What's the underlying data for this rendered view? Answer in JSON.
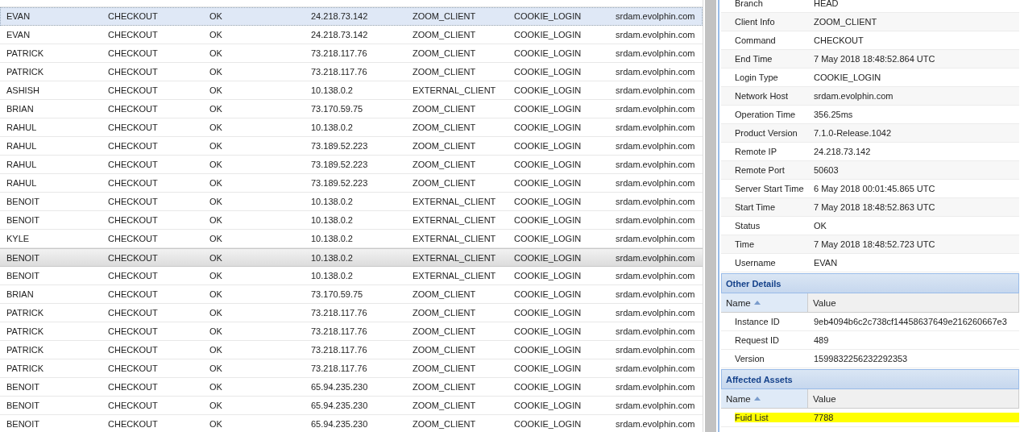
{
  "log_table": {
    "rows": [
      {
        "cells": [
          "EVAN",
          "CHECKOUT",
          "OK",
          "24.218.73.142",
          "ZOOM_CLIENT",
          "COOKIE_LOGIN",
          "srdam.evolphin.com"
        ],
        "selected": true,
        "hovered": false
      },
      {
        "cells": [
          "EVAN",
          "CHECKOUT",
          "OK",
          "24.218.73.142",
          "ZOOM_CLIENT",
          "COOKIE_LOGIN",
          "srdam.evolphin.com"
        ],
        "selected": false,
        "hovered": false
      },
      {
        "cells": [
          "PATRICK",
          "CHECKOUT",
          "OK",
          "73.218.117.76",
          "ZOOM_CLIENT",
          "COOKIE_LOGIN",
          "srdam.evolphin.com"
        ],
        "selected": false,
        "hovered": false
      },
      {
        "cells": [
          "PATRICK",
          "CHECKOUT",
          "OK",
          "73.218.117.76",
          "ZOOM_CLIENT",
          "COOKIE_LOGIN",
          "srdam.evolphin.com"
        ],
        "selected": false,
        "hovered": false
      },
      {
        "cells": [
          "ASHISH",
          "CHECKOUT",
          "OK",
          "10.138.0.2",
          "EXTERNAL_CLIENT",
          "COOKIE_LOGIN",
          "srdam.evolphin.com"
        ],
        "selected": false,
        "hovered": false
      },
      {
        "cells": [
          "BRIAN",
          "CHECKOUT",
          "OK",
          "73.170.59.75",
          "ZOOM_CLIENT",
          "COOKIE_LOGIN",
          "srdam.evolphin.com"
        ],
        "selected": false,
        "hovered": false
      },
      {
        "cells": [
          "RAHUL",
          "CHECKOUT",
          "OK",
          "10.138.0.2",
          "ZOOM_CLIENT",
          "COOKIE_LOGIN",
          "srdam.evolphin.com"
        ],
        "selected": false,
        "hovered": false
      },
      {
        "cells": [
          "RAHUL",
          "CHECKOUT",
          "OK",
          "73.189.52.223",
          "ZOOM_CLIENT",
          "COOKIE_LOGIN",
          "srdam.evolphin.com"
        ],
        "selected": false,
        "hovered": false
      },
      {
        "cells": [
          "RAHUL",
          "CHECKOUT",
          "OK",
          "73.189.52.223",
          "ZOOM_CLIENT",
          "COOKIE_LOGIN",
          "srdam.evolphin.com"
        ],
        "selected": false,
        "hovered": false
      },
      {
        "cells": [
          "RAHUL",
          "CHECKOUT",
          "OK",
          "73.189.52.223",
          "ZOOM_CLIENT",
          "COOKIE_LOGIN",
          "srdam.evolphin.com"
        ],
        "selected": false,
        "hovered": false
      },
      {
        "cells": [
          "BENOIT",
          "CHECKOUT",
          "OK",
          "10.138.0.2",
          "EXTERNAL_CLIENT",
          "COOKIE_LOGIN",
          "srdam.evolphin.com"
        ],
        "selected": false,
        "hovered": false
      },
      {
        "cells": [
          "BENOIT",
          "CHECKOUT",
          "OK",
          "10.138.0.2",
          "EXTERNAL_CLIENT",
          "COOKIE_LOGIN",
          "srdam.evolphin.com"
        ],
        "selected": false,
        "hovered": false
      },
      {
        "cells": [
          "KYLE",
          "CHECKOUT",
          "OK",
          "10.138.0.2",
          "EXTERNAL_CLIENT",
          "COOKIE_LOGIN",
          "srdam.evolphin.com"
        ],
        "selected": false,
        "hovered": false
      },
      {
        "cells": [
          "BENOIT",
          "CHECKOUT",
          "OK",
          "10.138.0.2",
          "EXTERNAL_CLIENT",
          "COOKIE_LOGIN",
          "srdam.evolphin.com"
        ],
        "selected": false,
        "hovered": true
      },
      {
        "cells": [
          "BENOIT",
          "CHECKOUT",
          "OK",
          "10.138.0.2",
          "EXTERNAL_CLIENT",
          "COOKIE_LOGIN",
          "srdam.evolphin.com"
        ],
        "selected": false,
        "hovered": false
      },
      {
        "cells": [
          "BRIAN",
          "CHECKOUT",
          "OK",
          "73.170.59.75",
          "ZOOM_CLIENT",
          "COOKIE_LOGIN",
          "srdam.evolphin.com"
        ],
        "selected": false,
        "hovered": false
      },
      {
        "cells": [
          "PATRICK",
          "CHECKOUT",
          "OK",
          "73.218.117.76",
          "ZOOM_CLIENT",
          "COOKIE_LOGIN",
          "srdam.evolphin.com"
        ],
        "selected": false,
        "hovered": false
      },
      {
        "cells": [
          "PATRICK",
          "CHECKOUT",
          "OK",
          "73.218.117.76",
          "ZOOM_CLIENT",
          "COOKIE_LOGIN",
          "srdam.evolphin.com"
        ],
        "selected": false,
        "hovered": false
      },
      {
        "cells": [
          "PATRICK",
          "CHECKOUT",
          "OK",
          "73.218.117.76",
          "ZOOM_CLIENT",
          "COOKIE_LOGIN",
          "srdam.evolphin.com"
        ],
        "selected": false,
        "hovered": false
      },
      {
        "cells": [
          "PATRICK",
          "CHECKOUT",
          "OK",
          "73.218.117.76",
          "ZOOM_CLIENT",
          "COOKIE_LOGIN",
          "srdam.evolphin.com"
        ],
        "selected": false,
        "hovered": false
      },
      {
        "cells": [
          "BENOIT",
          "CHECKOUT",
          "OK",
          "65.94.235.230",
          "ZOOM_CLIENT",
          "COOKIE_LOGIN",
          "srdam.evolphin.com"
        ],
        "selected": false,
        "hovered": false
      },
      {
        "cells": [
          "BENOIT",
          "CHECKOUT",
          "OK",
          "65.94.235.230",
          "ZOOM_CLIENT",
          "COOKIE_LOGIN",
          "srdam.evolphin.com"
        ],
        "selected": false,
        "hovered": false
      },
      {
        "cells": [
          "BENOIT",
          "CHECKOUT",
          "OK",
          "65.94.235.230",
          "ZOOM_CLIENT",
          "COOKIE_LOGIN",
          "srdam.evolphin.com"
        ],
        "selected": false,
        "hovered": false
      }
    ]
  },
  "details": {
    "properties": [
      {
        "name": "Branch",
        "value": "HEAD"
      },
      {
        "name": "Client Info",
        "value": "ZOOM_CLIENT"
      },
      {
        "name": "Command",
        "value": "CHECKOUT"
      },
      {
        "name": "End Time",
        "value": "7 May 2018 18:48:52.864 UTC"
      },
      {
        "name": "Login Type",
        "value": "COOKIE_LOGIN"
      },
      {
        "name": "Network Host",
        "value": "srdam.evolphin.com"
      },
      {
        "name": "Operation Time",
        "value": "356.25ms"
      },
      {
        "name": "Product Version",
        "value": "7.1.0-Release.1042"
      },
      {
        "name": "Remote IP",
        "value": "24.218.73.142"
      },
      {
        "name": "Remote Port",
        "value": "50603"
      },
      {
        "name": "Server Start Time",
        "value": "6 May 2018 00:01:45.865 UTC"
      },
      {
        "name": "Start Time",
        "value": "7 May 2018 18:48:52.863 UTC"
      },
      {
        "name": "Status",
        "value": "OK"
      },
      {
        "name": "Time",
        "value": "7 May 2018 18:48:52.723 UTC"
      },
      {
        "name": "Username",
        "value": "EVAN"
      }
    ],
    "sections": [
      {
        "title": "Other Details",
        "columns": [
          "Name",
          "Value"
        ],
        "rows": [
          {
            "name": "Instance ID",
            "value": "9eb4094b6c2c738cf14458637649e216260667e3",
            "highlighted": false
          },
          {
            "name": "Request ID",
            "value": "489",
            "highlighted": false
          },
          {
            "name": "Version",
            "value": "1599832256232292353",
            "highlighted": false
          }
        ]
      },
      {
        "title": "Affected Assets",
        "columns": [
          "Name",
          "Value"
        ],
        "rows": [
          {
            "name": "Fuid List",
            "value": "7788",
            "highlighted": true
          }
        ]
      }
    ]
  }
}
